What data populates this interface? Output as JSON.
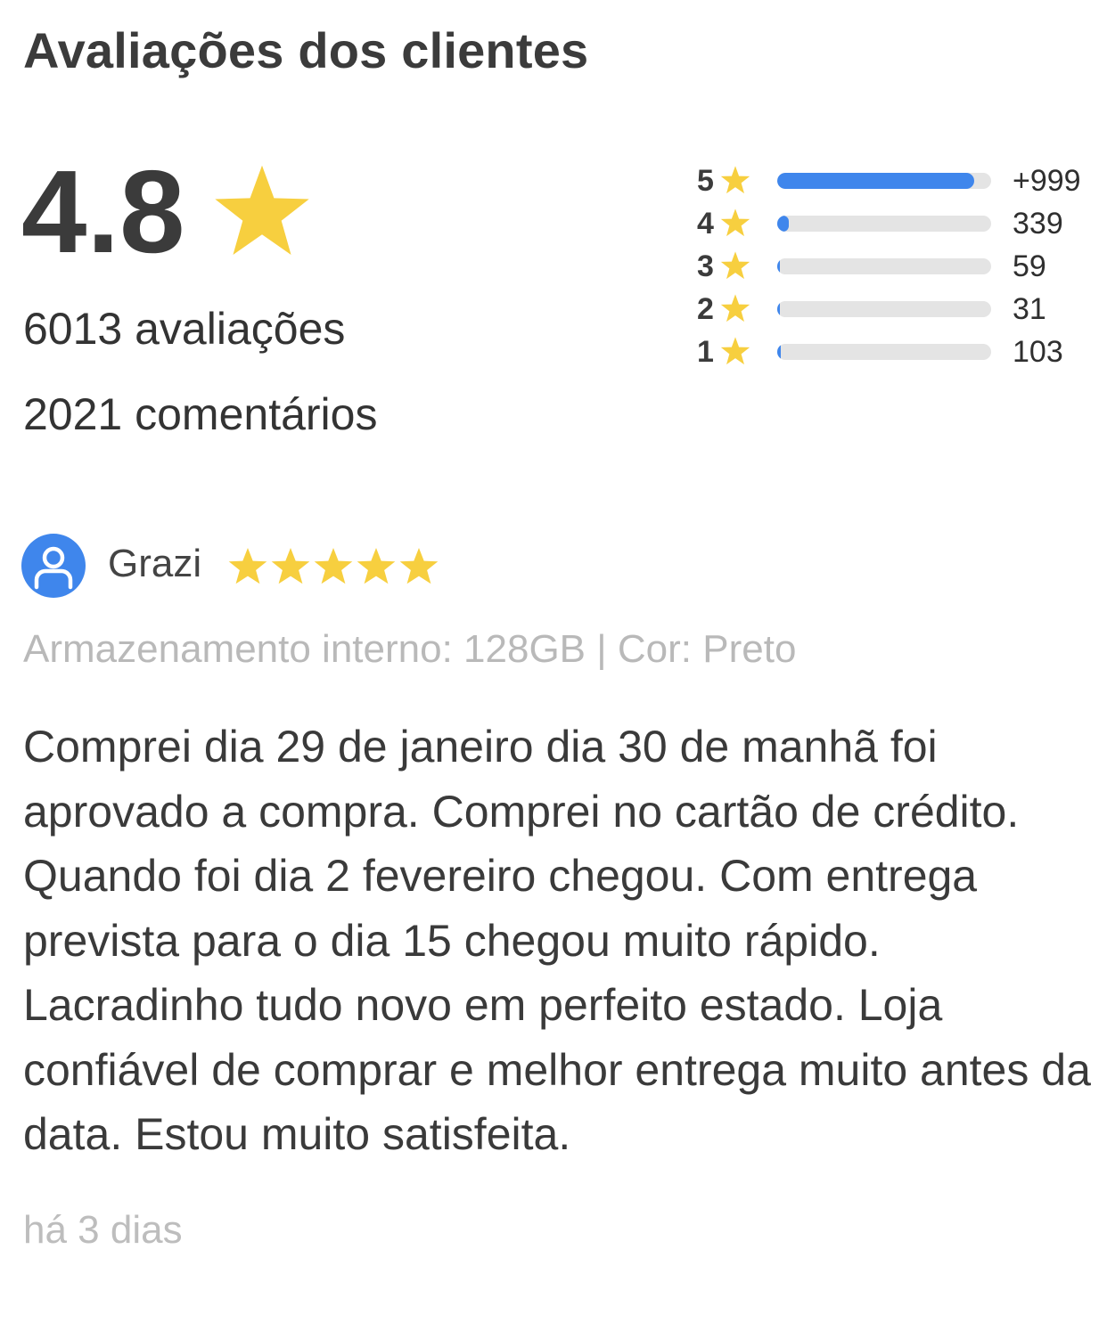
{
  "header": {
    "title": "Avaliações dos clientes"
  },
  "summary": {
    "score": "4.8",
    "ratings_count": "6013 avaliações",
    "comments_count": "2021 comentários",
    "star_icon": "star-icon",
    "star_color": "#f7cf3f"
  },
  "distribution": [
    {
      "stars": "5",
      "count": "+999",
      "fill_fraction": 0.92
    },
    {
      "stars": "4",
      "count": "339",
      "fill_fraction": 0.056
    },
    {
      "stars": "3",
      "count": "59",
      "fill_fraction": 0.01
    },
    {
      "stars": "2",
      "count": "31",
      "fill_fraction": 0.005
    },
    {
      "stars": "1",
      "count": "103",
      "fill_fraction": 0.017
    }
  ],
  "bar_color": "#3f86ec",
  "track_color": "#e4e4e4",
  "review": {
    "avatar_icon": "user-avatar-icon",
    "avatar_color": "#3f86ec",
    "name": "Grazi",
    "rating": 5,
    "variant": "Armazenamento interno: 128GB | Cor: Preto",
    "text": "Comprei dia 29 de janeiro dia 30 de manhã foi aprovado a compra. Comprei no cartão de crédito. Quando foi dia 2 fevereiro chegou. Com entrega prevista para o dia 15 chegou muito rápido. Lacradinho tudo novo em perfeito estado. Loja confiável de comprar e melhor entrega muito antes da data. Estou muito satisfeita.",
    "date": "há 3 dias"
  }
}
